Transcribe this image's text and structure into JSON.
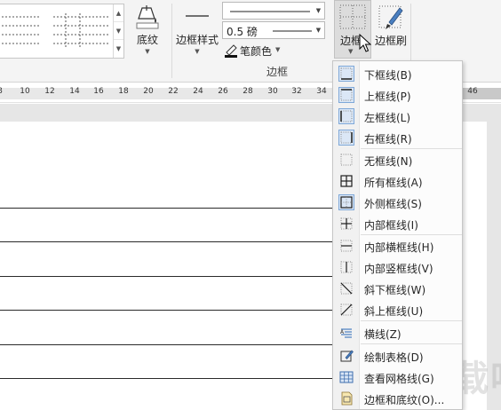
{
  "ribbon": {
    "shading_label": "底纹",
    "border_styles_label": "边框样式",
    "pen_weight_value": "0.5 磅",
    "pen_color_label": "笔颜色",
    "borders_label": "边框",
    "border_painter_label": "边框刷",
    "group_label": "边框"
  },
  "ruler": {
    "ticks": [
      "8",
      "10",
      "12",
      "14",
      "16",
      "18",
      "20",
      "22",
      "24",
      "26",
      "28",
      "30",
      "32",
      "34",
      "46"
    ]
  },
  "menu": {
    "items": [
      {
        "label": "下框线(B)",
        "icon": "bottom-border-icon"
      },
      {
        "label": "上框线(P)",
        "icon": "top-border-icon"
      },
      {
        "label": "左框线(L)",
        "icon": "left-border-icon"
      },
      {
        "label": "右框线(R)",
        "icon": "right-border-icon"
      },
      {
        "label": "无框线(N)",
        "icon": "no-border-icon"
      },
      {
        "label": "所有框线(A)",
        "icon": "all-borders-icon"
      },
      {
        "label": "外侧框线(S)",
        "icon": "outside-borders-icon"
      },
      {
        "label": "内部框线(I)",
        "icon": "inside-borders-icon"
      },
      {
        "label": "内部横框线(H)",
        "icon": "inside-horizontal-border-icon"
      },
      {
        "label": "内部竖框线(V)",
        "icon": "inside-vertical-border-icon"
      },
      {
        "label": "斜下框线(W)",
        "icon": "diagonal-down-border-icon"
      },
      {
        "label": "斜上框线(U)",
        "icon": "diagonal-up-border-icon"
      },
      {
        "label": "横线(Z)",
        "icon": "horizontal-line-icon"
      },
      {
        "label": "绘制表格(D)",
        "icon": "draw-table-icon"
      },
      {
        "label": "查看网格线(G)",
        "icon": "view-gridlines-icon"
      },
      {
        "label": "边框和底纹(O)...",
        "icon": "borders-and-shading-icon"
      }
    ]
  },
  "watermark": "下载吧"
}
